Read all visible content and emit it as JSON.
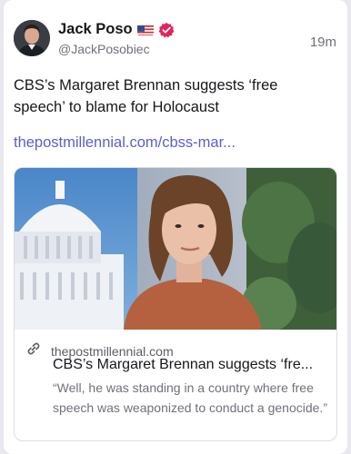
{
  "author": {
    "name": "Jack Poso",
    "handle": "@JackPosobiec",
    "flag_icon": "us-flag-icon",
    "verified_icon": "verified-badge-icon"
  },
  "time": "19m",
  "post": {
    "text": "CBS’s Margaret Brennan suggests ‘free speech’ to blame for Holocaust",
    "link": "thepostmillennial.com/cbss-mar..."
  },
  "preview": {
    "domain": "thepostmillennial.com",
    "title": "CBS’s Margaret Brennan suggests ‘fre...",
    "description": "“Well, he was standing in a country where free speech was weaponized to conduct a genocide.”",
    "link_icon": "link-icon"
  },
  "colors": {
    "link": "#5b5fc7",
    "verified": "#e0245e",
    "muted": "#70707a"
  }
}
